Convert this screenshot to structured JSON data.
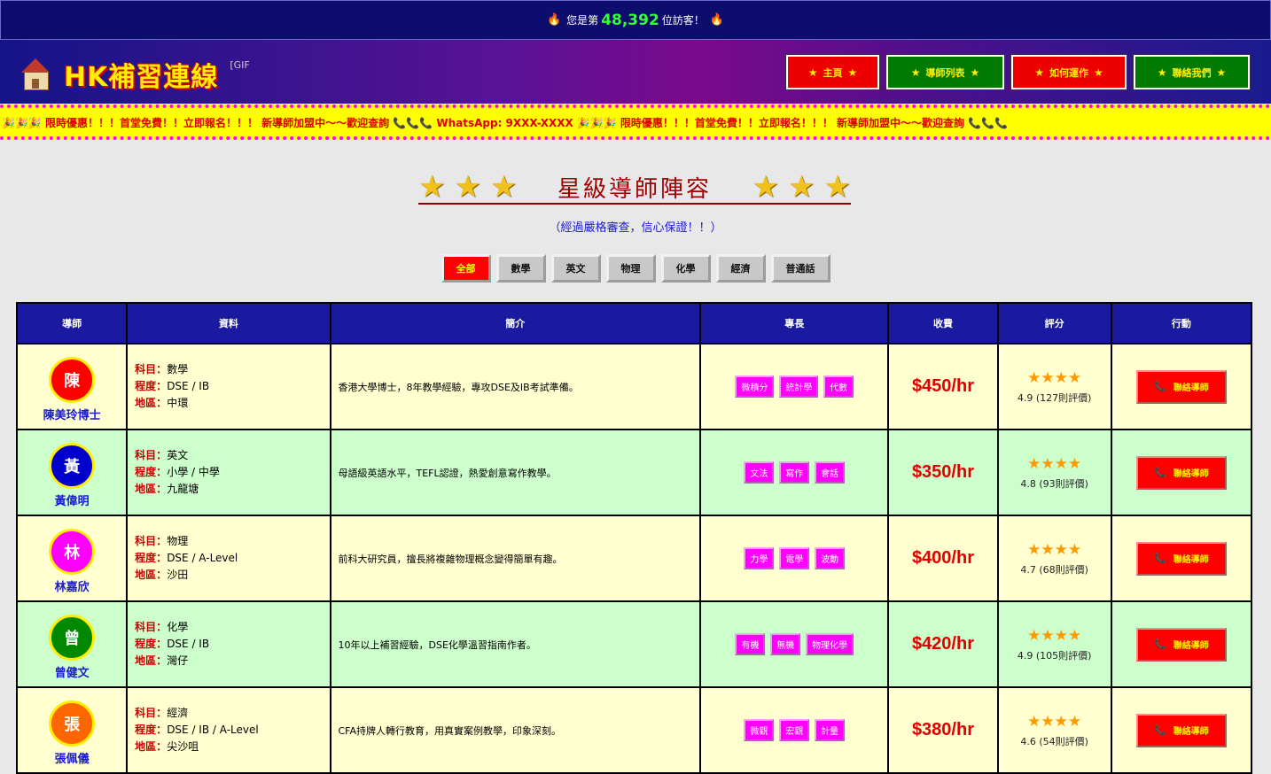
{
  "counter": {
    "prefix": "您是第",
    "number": "48,392",
    "suffix": "位訪客！",
    "icon": "fire-icon"
  },
  "header": {
    "logo_text": "HK補習連線",
    "logo_icon": "school-house-icon",
    "gif_alt": "[GIF",
    "nav": [
      {
        "label": "主頁",
        "style": "red"
      },
      {
        "label": "導師列表",
        "style": "green"
      },
      {
        "label": "如何運作",
        "style": "red"
      },
      {
        "label": "聯絡我們",
        "style": "green"
      }
    ]
  },
  "marquee": {
    "text": "🎉🎉🎉 限時優惠！！！首堂免費！！立即報名！！！ 新導師加盟中～～歡迎查詢 📞📞📞 WhatsApp: 9XXX-XXXX 🎉🎉🎉 限時優惠！！！首堂免費！！立即報名！！！ 新導師加盟中～～歡迎查詢 📞📞📞"
  },
  "section": {
    "title": "星級導師陣容",
    "subtitle": "（經過嚴格審查，信心保證！！）"
  },
  "filters": [
    "全部",
    "數學",
    "英文",
    "物理",
    "化學",
    "經濟",
    "普通話"
  ],
  "table": {
    "headers": [
      "導師",
      "資料",
      "簡介",
      "專長",
      "收費",
      "評分",
      "行動"
    ],
    "labels": {
      "subject": "科目：",
      "level": "程度：",
      "area": "地區："
    },
    "contact_label": "聯絡導師",
    "rows": [
      {
        "initial": "陳",
        "name": "陳美玲博士",
        "color": "#ff0000",
        "subject": "數學",
        "level": "DSE / IB",
        "area": "中環",
        "intro": "香港大學博士，8年教學經驗，專攻DSE及IB考試準備。",
        "tags": [
          "微積分",
          "統計學",
          "代數"
        ],
        "fee": "$450/hr",
        "stars": "★★★★",
        "rating": "4.9 (127則評價)"
      },
      {
        "initial": "黃",
        "name": "黃偉明",
        "color": "#0000cc",
        "subject": "英文",
        "level": "小學 / 中學",
        "area": "九龍塘",
        "intro": "母語級英語水平，TEFL認證，熱愛創意寫作教學。",
        "tags": [
          "文法",
          "寫作",
          "會話"
        ],
        "fee": "$350/hr",
        "stars": "★★★★",
        "rating": "4.8 (93則評價)"
      },
      {
        "initial": "林",
        "name": "林嘉欣",
        "color": "#ff00ff",
        "subject": "物理",
        "level": "DSE / A-Level",
        "area": "沙田",
        "intro": "前科大研究員，擅長將複雜物理概念變得簡單有趣。",
        "tags": [
          "力學",
          "電學",
          "波動"
        ],
        "fee": "$400/hr",
        "stars": "★★★★",
        "rating": "4.7 (68則評價)"
      },
      {
        "initial": "曾",
        "name": "曾健文",
        "color": "#008800",
        "subject": "化學",
        "level": "DSE / IB",
        "area": "灣仔",
        "intro": "10年以上補習經驗，DSE化學溫習指南作者。",
        "tags": [
          "有機",
          "無機",
          "物理化學"
        ],
        "fee": "$420/hr",
        "stars": "★★★★",
        "rating": "4.9 (105則評價)"
      },
      {
        "initial": "張",
        "name": "張佩儀",
        "color": "#ff6600",
        "subject": "經濟",
        "level": "DSE / IB / A-Level",
        "area": "尖沙咀",
        "intro": "CFA持牌人轉行教育，用真實案例教學，印象深刻。",
        "tags": [
          "微觀",
          "宏觀",
          "計量"
        ],
        "fee": "$380/hr",
        "stars": "★★★★",
        "rating": "4.6 (54則評價)"
      }
    ]
  }
}
